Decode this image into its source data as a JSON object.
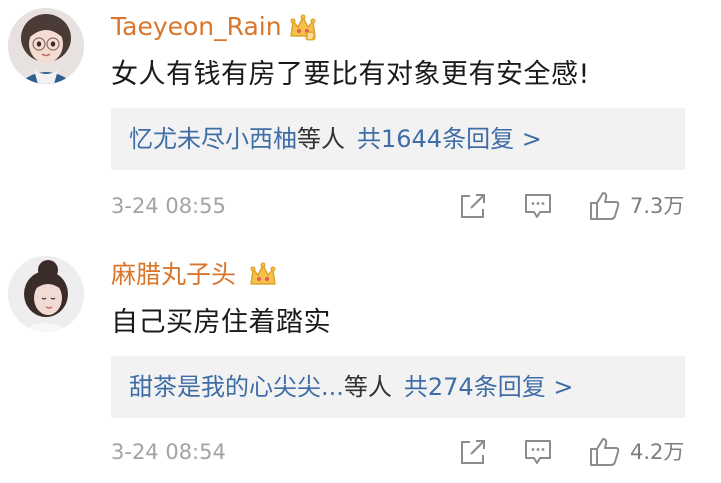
{
  "comments": [
    {
      "username": "Taeyeon_Rain",
      "text": "女人有钱有房了要比有对象更有安全感!",
      "replies": {
        "names": "忆尤未尽小西柚",
        "suffix": "等人",
        "count": "共1644条回复 >"
      },
      "timestamp": "3-24 08:55",
      "likes": "7.3万"
    },
    {
      "username": "麻腊丸子头",
      "text": "自己买房住着踏实",
      "replies": {
        "names": "甜茶是我的心尖尖...",
        "suffix": "等人",
        "count": "共274条回复 >"
      },
      "timestamp": "3-24 08:54",
      "likes": "4.2万"
    }
  ],
  "icons": {
    "share": "share-icon",
    "comment": "comment-icon",
    "like": "thumbs-up-icon",
    "badge": "crown-badge-icon"
  },
  "colors": {
    "username": "#d9762b",
    "link": "#3f6da6",
    "reply_bg": "#f2f2f2",
    "meta": "#a3a3a3",
    "crown": "#f0b43a"
  }
}
